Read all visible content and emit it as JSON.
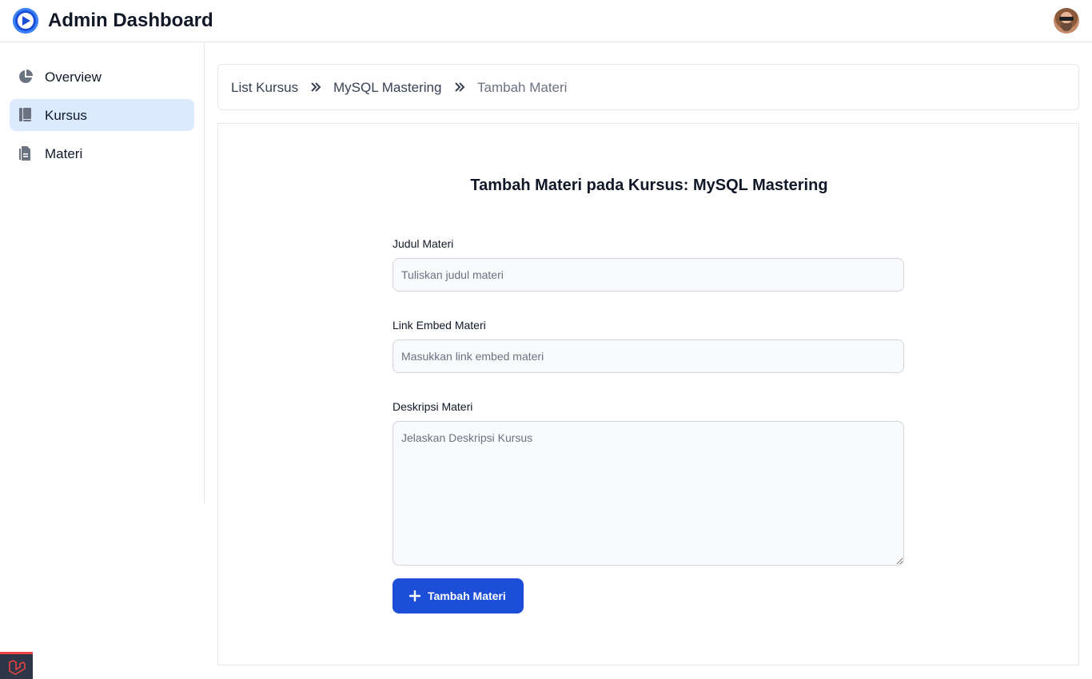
{
  "app": {
    "title": "Admin Dashboard"
  },
  "sidebar": {
    "items": [
      {
        "label": "Overview",
        "icon": "pie-chart-icon"
      },
      {
        "label": "Kursus",
        "icon": "book-icon",
        "active": true
      },
      {
        "label": "Materi",
        "icon": "document-icon"
      }
    ]
  },
  "breadcrumb": {
    "items": [
      "List Kursus",
      "MySQL Mastering",
      "Tambah Materi"
    ]
  },
  "form": {
    "title": "Tambah Materi pada Kursus: MySQL Mastering",
    "judul": {
      "label": "Judul Materi",
      "placeholder": "Tuliskan judul materi",
      "value": ""
    },
    "link": {
      "label": "Link Embed Materi",
      "placeholder": "Masukkan link embed materi",
      "value": ""
    },
    "deskripsi": {
      "label": "Deskripsi Materi",
      "placeholder": "Jelaskan Deskripsi Kursus",
      "value": ""
    },
    "submit_label": "Tambah Materi"
  },
  "colors": {
    "accent": "#1d4ed8",
    "active_nav_bg": "#dbeafe",
    "laravel_red": "#ef4444"
  }
}
